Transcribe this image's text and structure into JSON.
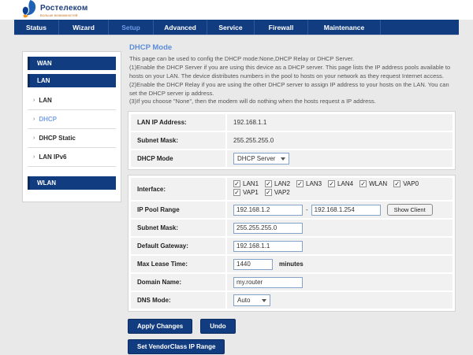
{
  "brand": {
    "name": "Ростелеком",
    "tagline": "Больше возможностей"
  },
  "nav": {
    "items": [
      {
        "label": "Status",
        "active": false
      },
      {
        "label": "Wizard",
        "active": false
      },
      {
        "label": "Setup",
        "active": true
      },
      {
        "label": "Advanced",
        "active": false
      },
      {
        "label": "Service",
        "active": false
      },
      {
        "label": "Firewall",
        "active": false
      },
      {
        "label": "Maintenance",
        "active": false
      }
    ]
  },
  "sidebar": {
    "wan_label": "WAN",
    "lan_label": "LAN",
    "wlan_label": "WLAN",
    "item_arrow": "›",
    "lan_items": [
      {
        "label": "LAN",
        "active": false
      },
      {
        "label": "DHCP",
        "active": true
      },
      {
        "label": "DHCP Static",
        "active": false
      },
      {
        "label": "LAN IPv6",
        "active": false
      }
    ]
  },
  "page": {
    "title": "DHCP Mode",
    "description": [
      "This page can be used to config the DHCP mode:None,DHCP Relay or DHCP Server.",
      "(1)Enable the DHCP Server if you are using this device as a DHCP server. This page lists the IP address pools available to hosts on your LAN. The device distributes numbers in the pool to hosts on your network as they request Internet access.",
      "(2)Enable the DHCP Relay if you are using the other DHCP server to assign IP address to your hosts on the LAN. You can set the DHCP server ip address.",
      "(3)If you choose \"None\", then the modem will do nothing when the hosts request a IP address."
    ]
  },
  "info": {
    "lan_ip": {
      "label": "LAN IP Address:",
      "value": "192.168.1.1"
    },
    "subnet": {
      "label": "Subnet Mask:",
      "value": "255.255.255.0"
    },
    "dhcp_mode": {
      "label": "DHCP Mode",
      "value": "DHCP Server"
    }
  },
  "form": {
    "interface": {
      "label": "Interface:",
      "checked_glyph": "✓",
      "options": [
        "LAN1",
        "LAN2",
        "LAN3",
        "LAN4",
        "WLAN",
        "VAP0",
        "VAP1",
        "VAP2"
      ]
    },
    "ip_pool": {
      "label": "IP Pool Range",
      "from": "192.168.1.2",
      "separator": "-",
      "to": "192.168.1.254",
      "button": "Show Client"
    },
    "subnet": {
      "label": "Subnet Mask:",
      "value": "255.255.255.0"
    },
    "gateway": {
      "label": "Default Gateway:",
      "value": "192.168.1.1"
    },
    "lease": {
      "label": "Max Lease Time:",
      "value": "1440",
      "suffix": "minutes"
    },
    "domain": {
      "label": "Domain Name:",
      "value": "my.router"
    },
    "dns": {
      "label": "DNS Mode:",
      "value": "Auto"
    }
  },
  "buttons": {
    "apply": "Apply Changes",
    "undo": "Undo",
    "vendorclass": "Set VendorClass IP Range"
  },
  "colors": {
    "navy": "#123c80",
    "active_link": "#6f9be8",
    "title_blue": "#5b8dd9"
  }
}
